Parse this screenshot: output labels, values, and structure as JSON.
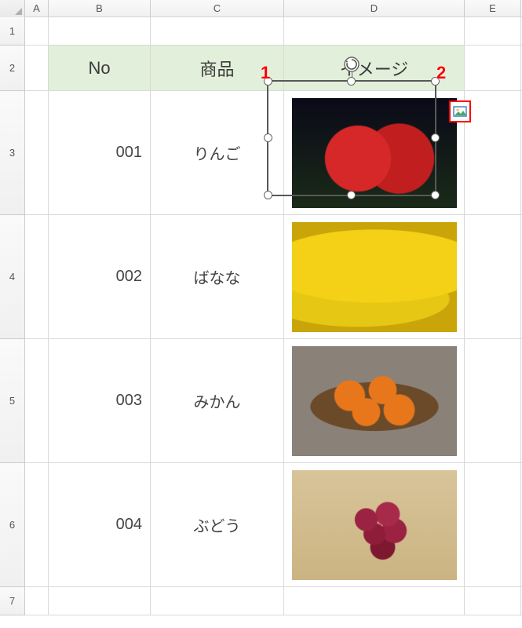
{
  "columns": {
    "A": "A",
    "B": "B",
    "C": "C",
    "D": "D",
    "E": "E"
  },
  "rowLabels": {
    "r1": "1",
    "r2": "2",
    "r3": "3",
    "r4": "4",
    "r5": "5",
    "r6": "6",
    "r7": "7"
  },
  "headers": {
    "no": "No",
    "product": "商品",
    "image": "イメージ"
  },
  "rows": [
    {
      "no": "001",
      "product": "りんご",
      "image_name": "apple-image"
    },
    {
      "no": "002",
      "product": "ばなな",
      "image_name": "banana-image"
    },
    {
      "no": "003",
      "product": "みかん",
      "image_name": "orange-image"
    },
    {
      "no": "004",
      "product": "ぶどう",
      "image_name": "grape-image"
    }
  ],
  "callouts": {
    "one": "1",
    "two": "2"
  },
  "selection": {
    "target_row": 0
  },
  "icons": {
    "rotate": "rotate-icon",
    "format": "picture-format-icon"
  },
  "colors": {
    "header_fill": "#e2efda",
    "callout": "#ff0000",
    "grid": "#d9d9d9"
  }
}
